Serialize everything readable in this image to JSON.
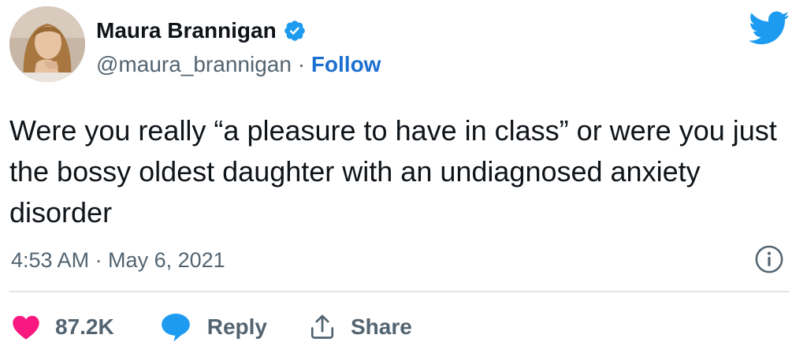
{
  "author": {
    "display_name": "Maura Brannigan",
    "handle": "@maura_brannigan",
    "separator": "·",
    "follow_label": "Follow",
    "verified": true
  },
  "tweet": {
    "text": "Were you really “a pleasure to have in class” or were you just the bossy oldest daughter with an undiagnosed anxiety disorder",
    "timestamp": "4:53 AM · May 6, 2021"
  },
  "actions": {
    "like_count": "87.2K",
    "reply_label": "Reply",
    "share_label": "Share"
  },
  "icons": {
    "brand": "twitter-bird-icon",
    "verified": "verified-badge-icon",
    "info": "info-icon",
    "like": "heart-icon",
    "reply": "speech-bubble-icon",
    "share": "share-upload-icon"
  },
  "colors": {
    "brand_blue": "#1d9bf0",
    "follow_blue": "#1b6fd0",
    "like_red": "#f91880",
    "reply_blue": "#1d9bf0",
    "text_primary": "#0f1419",
    "text_secondary": "#536471",
    "divider": "#e1e6ea"
  }
}
